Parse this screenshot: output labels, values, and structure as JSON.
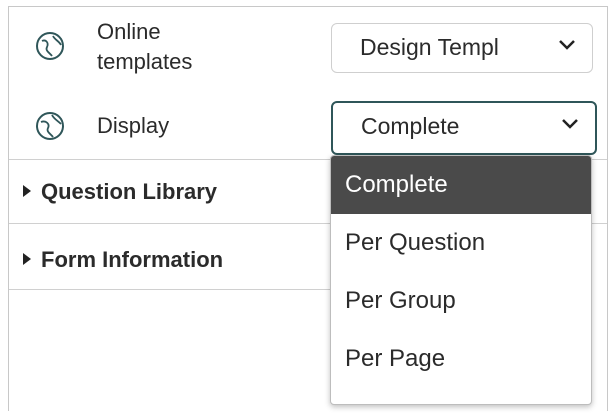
{
  "online_templates": {
    "label": "Online\ntemplates",
    "select_value": "Design Templ",
    "icon": "globe-icon"
  },
  "display": {
    "label": "Display",
    "select_value": "Complete",
    "icon": "globe-icon",
    "options": [
      "Complete",
      "Per Question",
      "Per Group",
      "Per Page"
    ],
    "selected_index": 0
  },
  "sections": [
    {
      "label": "Question Library"
    },
    {
      "label": "Form Information"
    }
  ],
  "colors": {
    "active_border": "#2f5659",
    "selected_option_bg": "#4a4a4a"
  }
}
